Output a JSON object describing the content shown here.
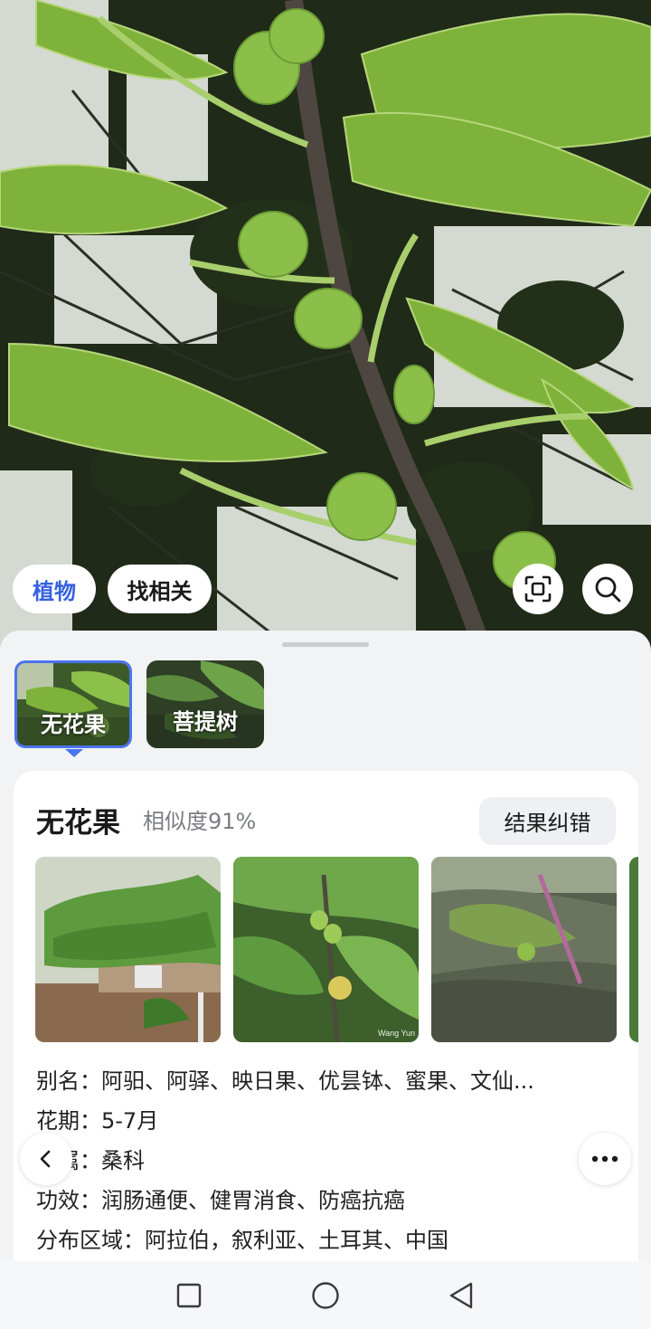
{
  "photo": {
    "chips": {
      "plant": "植物",
      "related": "找相关"
    }
  },
  "candidates": [
    {
      "label": "无花果",
      "selected": true
    },
    {
      "label": "菩提树",
      "selected": false
    }
  ],
  "result": {
    "name": "无花果",
    "similarity": "相似度91%",
    "fix_button": "结果纠错",
    "info": [
      {
        "label": "别名：",
        "value": "阿驲、阿驿、映日果、优昙钵、蜜果、文仙..."
      },
      {
        "label": "花期：",
        "value": "5-7月"
      },
      {
        "label": "科属：",
        "value": "桑科"
      },
      {
        "label": "功效：",
        "value": "润肠通便、健胃消食、防癌抗癌"
      },
      {
        "label": "分布区域：",
        "value": "阿拉伯，叙利亚、土耳其、中国"
      }
    ],
    "gallery_watermark": "Wang Yun"
  },
  "colors": {
    "accent": "#3461e0",
    "selected_border": "#4a74f0",
    "leaf": "#7fb23a",
    "fig": "#8bbf4a"
  },
  "icons": {
    "scan": "scan-icon",
    "search": "search-icon",
    "back": "chevron-left-icon",
    "more": "more-icon"
  }
}
